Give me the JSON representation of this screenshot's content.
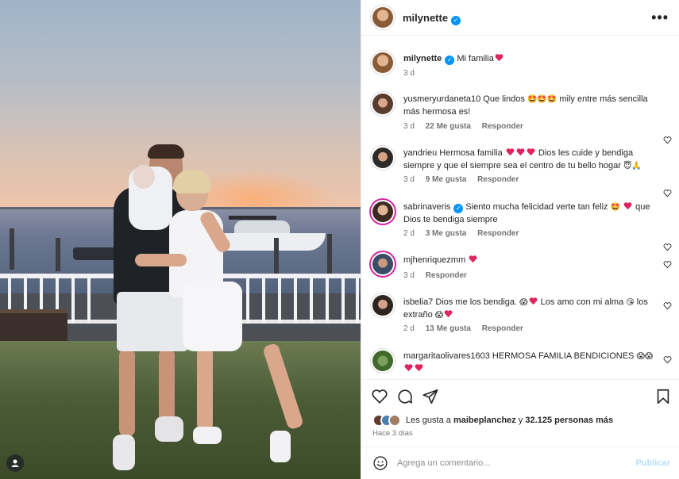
{
  "post": {
    "username": "milynette",
    "verified": true,
    "caption_text": "Mi familia",
    "caption_emoji": "red-heart",
    "caption_age": "3 d"
  },
  "comments": [
    {
      "username": "yusmeryurdaneta10",
      "text_before": "Que lindos",
      "emojis_1": "heart-eyes heart-eyes heart-eyes",
      "text_after": "mily entre más sencilla más hermosa es!",
      "age": "3 d",
      "likes": "22 Me gusta",
      "reply": "Responder"
    },
    {
      "username": "yandrieu",
      "text_before": "Hermosa familia",
      "emojis_1": "red-heart red-heart red-heart",
      "text_after": "Dios les cuide y bendiga siempre y que el siempre sea el centro de tu bello hogar",
      "emojis_2": "smiling-halo folded-hands",
      "age": "3 d",
      "likes": "9 Me gusta",
      "reply": "Responder"
    },
    {
      "username": "sabrinaveris",
      "verified": true,
      "text_before": "Siento mucha felicidad verte tan feliz",
      "emojis_1": "star-struck red-heart",
      "text_after": "que Dios te bendiga siempre",
      "age": "2 d",
      "likes": "3 Me gusta",
      "reply": "Responder"
    },
    {
      "username": "mjhenriquezmm",
      "emojis_1": "red-heart",
      "age": "3 d",
      "reply": "Responder"
    },
    {
      "username": "isbelia7",
      "text_before": "Dios me los bendiga.",
      "emojis_1": "screaming-face red-heart",
      "text_after": "Los amo con mi alma",
      "emojis_2": "blowing-kiss",
      "text_after2": "los extraño",
      "emojis_3": "screaming-face red-heart",
      "age": "2 d",
      "likes": "13 Me gusta",
      "reply": "Responder"
    },
    {
      "username": "margaritaolivares1603",
      "text_before": "HERMOSA FAMILIA BENDICIONES",
      "emojis_1": "screaming-face screaming-face red-heart red-heart"
    }
  ],
  "likes_summary": {
    "prefix": "Les gusta a",
    "user": "maibeplanchez",
    "middle": "y",
    "count": "32.125 personas más"
  },
  "posted_ago": "Hace 3 días",
  "composer": {
    "placeholder": "Agrega un comentario...",
    "post_label": "Publicar"
  },
  "colors": {
    "verified_blue": "#0095f6",
    "heart_red": "#e0245e",
    "publish_disabled": "#b2dffc",
    "muted_text": "#737373"
  }
}
